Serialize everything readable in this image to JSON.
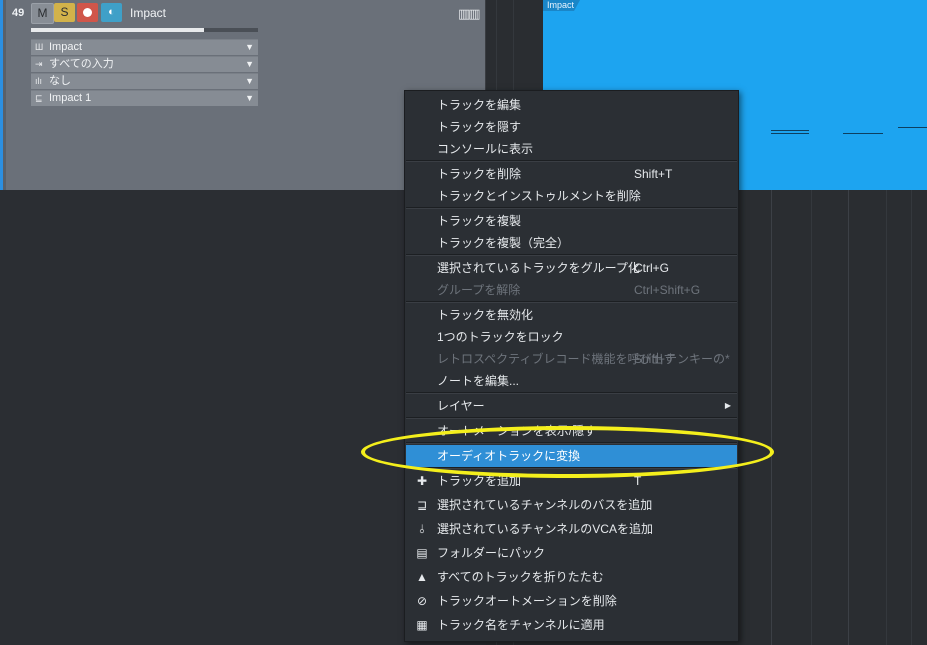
{
  "track": {
    "number": "49",
    "mute": "M",
    "solo": "S",
    "monitor": "◐",
    "name": "Impact",
    "volume_fraction": 0.76,
    "io_rows": [
      {
        "icon": "instrument-icon",
        "glyph": "Ш",
        "label": "Impact"
      },
      {
        "icon": "input-icon",
        "glyph": "⇥",
        "label": "すべての入力"
      },
      {
        "icon": "level-icon",
        "glyph": "ılı",
        "label": "なし"
      },
      {
        "icon": "output-icon",
        "glyph": "⊑",
        "label": "Impact 1"
      }
    ]
  },
  "clip": {
    "label": "Impact",
    "color": "#1da4f0"
  },
  "menu": {
    "items": [
      {
        "label": "トラックを編集"
      },
      {
        "label": "トラックを隠す"
      },
      {
        "label": "コンソールに表示"
      },
      {
        "label": "トラックを削除",
        "shortcut": "Shift+T"
      },
      {
        "label": "トラックとインストゥルメントを削除"
      },
      {
        "label": "トラックを複製"
      },
      {
        "label": "トラックを複製（完全）"
      },
      {
        "label": "選択されているトラックをグループ化",
        "shortcut": "Ctrl+G"
      },
      {
        "label": "グループを解除",
        "shortcut": "Ctrl+Shift+G",
        "disabled": true
      },
      {
        "label": "トラックを無効化"
      },
      {
        "label": "1つのトラックをロック"
      },
      {
        "label": "レトロスペクティブレコード機能を呼び出す",
        "shortcut": "Shift+テンキーの*",
        "disabled": true
      },
      {
        "label": "ノートを編集..."
      },
      {
        "label": "レイヤー",
        "submenu": "▶"
      },
      {
        "label": "オートメーションを表示/隠す"
      },
      {
        "label": "オーディオトラックに変換",
        "highlighted": true
      },
      {
        "label": "トラックを追加",
        "shortcut": "T",
        "icon": "plus-icon"
      },
      {
        "label": "選択されているチャンネルのバスを追加",
        "icon": "bus-icon"
      },
      {
        "label": "選択されているチャンネルのVCAを追加",
        "icon": "vca-icon"
      },
      {
        "label": "フォルダーにパック",
        "icon": "folder-pack-icon"
      },
      {
        "label": "すべてのトラックを折りたたむ",
        "icon": "collapse-icon"
      },
      {
        "label": "トラックオートメーションを削除",
        "icon": "remove-automation-icon"
      },
      {
        "label": "トラック名をチャンネルに適用",
        "icon": "apply-name-icon"
      }
    ]
  },
  "colors": {
    "menu_highlight": "#2f8fd6",
    "annotation": "#f4ef1c"
  }
}
